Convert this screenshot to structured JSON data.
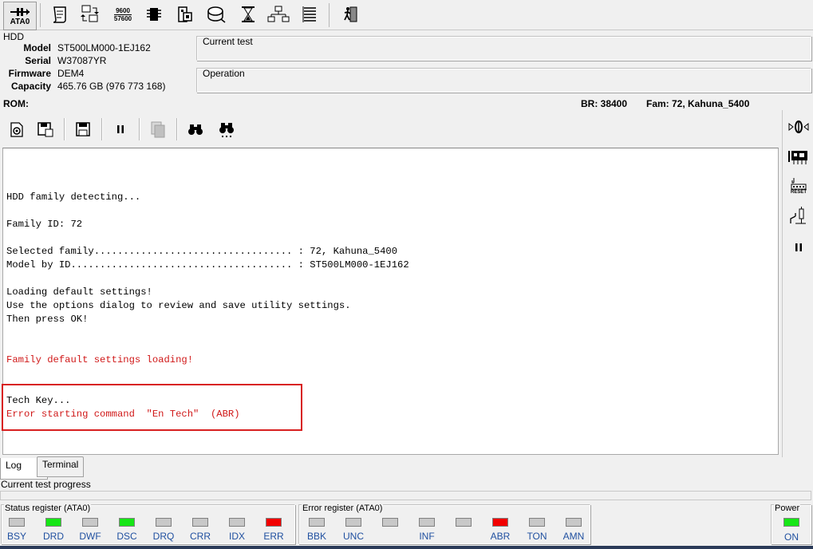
{
  "toolbar": {
    "ata_label": "ATA0",
    "baud_top": "9600",
    "baud_bottom": "57600"
  },
  "hdd": {
    "title": "HDD",
    "fields": [
      {
        "key": "Model",
        "value": "ST500LM000-1EJ162"
      },
      {
        "key": "Serial",
        "value": "W37087YR"
      },
      {
        "key": "Firmware",
        "value": "DEM4"
      },
      {
        "key": "Capacity",
        "value": "465.76 GB (976 773 168)"
      }
    ]
  },
  "current_test": {
    "caption": "Current test"
  },
  "operation": {
    "caption": "Operation"
  },
  "rom_row": {
    "rom": "ROM:",
    "br": "BR: 38400",
    "fam": "Fam: 72, Kahuna_5400"
  },
  "log": {
    "lines": [
      {
        "text": "HDD family detecting...",
        "color": "black"
      },
      {
        "text": "",
        "color": "black"
      },
      {
        "text": "Family ID: 72",
        "color": "black"
      },
      {
        "text": "",
        "color": "black"
      },
      {
        "text": "Selected family.................................. : 72, Kahuna_5400",
        "color": "black"
      },
      {
        "text": "Model by ID...................................... : ST500LM000-1EJ162",
        "color": "black"
      },
      {
        "text": "",
        "color": "black"
      },
      {
        "text": "Loading default settings!",
        "color": "black"
      },
      {
        "text": "Use the options dialog to review and save utility settings.",
        "color": "black"
      },
      {
        "text": "Then press OK!",
        "color": "black"
      },
      {
        "text": "",
        "color": "black"
      },
      {
        "text": "",
        "color": "black"
      },
      {
        "text": "Family default settings loading!",
        "color": "red"
      },
      {
        "text": "",
        "color": "black"
      },
      {
        "text": "",
        "color": "black"
      },
      {
        "text": "Tech Key...",
        "color": "black"
      },
      {
        "text": "Error starting command  \"En Tech\"  (ABR)",
        "color": "red"
      }
    ]
  },
  "right_toolbar": {
    "reset_label": "RESET"
  },
  "tabs": [
    {
      "label": "Log",
      "active": true
    },
    {
      "label": "Terminal",
      "active": false
    }
  ],
  "progress": {
    "label": "Current test progress",
    "value": 0
  },
  "status_register": {
    "caption": "Status register (ATA0)",
    "bits": [
      {
        "label": "BSY",
        "state": "off"
      },
      {
        "label": "DRD",
        "state": "green"
      },
      {
        "label": "DWF",
        "state": "off"
      },
      {
        "label": "DSC",
        "state": "green"
      },
      {
        "label": "DRQ",
        "state": "off"
      },
      {
        "label": "CRR",
        "state": "off"
      },
      {
        "label": "IDX",
        "state": "off"
      },
      {
        "label": "ERR",
        "state": "red"
      }
    ]
  },
  "error_register": {
    "caption": "Error register (ATA0)",
    "bits": [
      {
        "label": "BBK",
        "state": "off"
      },
      {
        "label": "UNC",
        "state": "off"
      },
      {
        "label": "",
        "state": "off"
      },
      {
        "label": "INF",
        "state": "off"
      },
      {
        "label": "",
        "state": "off"
      },
      {
        "label": "ABR",
        "state": "red"
      },
      {
        "label": "TON",
        "state": "off"
      },
      {
        "label": "AMN",
        "state": "off"
      }
    ]
  },
  "power": {
    "caption": "Power",
    "label": "ON",
    "state": "green"
  },
  "colors": {
    "led_green": "#16e616",
    "led_red": "#f20000",
    "log_red": "#d01818",
    "highlight_box": "#d82020"
  }
}
